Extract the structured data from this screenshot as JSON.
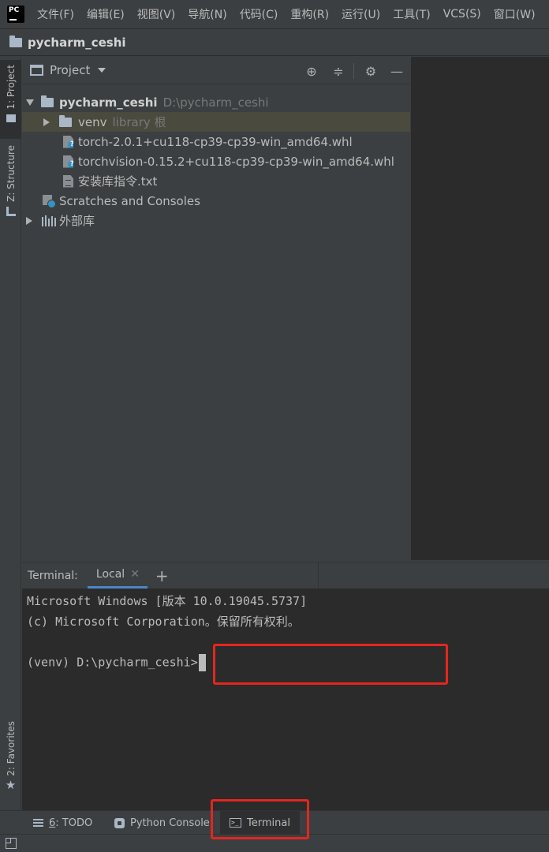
{
  "menu": {
    "logo_text": "PC",
    "items": [
      "文件(F)",
      "编辑(E)",
      "视图(V)",
      "导航(N)",
      "代码(C)",
      "重构(R)",
      "运行(U)",
      "工具(T)",
      "VCS(S)",
      "窗口(W)"
    ]
  },
  "navbar": {
    "project_name": "pycharm_ceshi"
  },
  "left_strip": {
    "project_tab": "1: Project",
    "structure_tab": "Z: Structure",
    "favorites_tab": "2: Favorites"
  },
  "project_panel": {
    "title": "Project",
    "tree": {
      "root_name": "pycharm_ceshi",
      "root_path": "D:\\pycharm_ceshi",
      "venv_name": "venv",
      "venv_hint": "library 根",
      "file_torch": "torch-2.0.1+cu118-cp39-cp39-win_amd64.whl",
      "file_torchvision": "torchvision-0.15.2+cu118-cp39-cp39-win_amd64.whl",
      "file_txt": "安装库指令.txt",
      "scratches": "Scratches and Consoles",
      "external_libs": "外部库"
    }
  },
  "terminal": {
    "label": "Terminal:",
    "tab_local": "Local",
    "lines": [
      "Microsoft Windows [版本 10.0.19045.5737]",
      "(c) Microsoft Corporation。保留所有权利。",
      "(venv) D:\\pycharm_ceshi>"
    ]
  },
  "bottom_tabs": {
    "todo_num": "6",
    "todo_label": ": TODO",
    "python_console": "Python Console",
    "terminal": "Terminal"
  },
  "colors": {
    "background": "#3c3f41",
    "editor": "#2b2b2b",
    "highlight_box": "#e3261f",
    "tab_underline": "#4a88c7"
  }
}
